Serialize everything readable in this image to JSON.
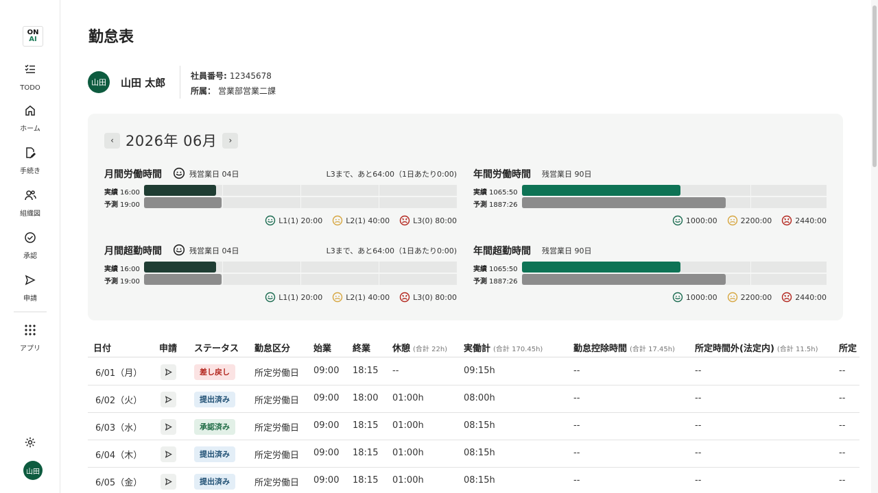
{
  "sidebar": {
    "logo_top": "ON",
    "logo_bottom": "AI",
    "items": [
      {
        "label": "TODO",
        "icon": "todo-list-icon"
      },
      {
        "label": "ホーム",
        "icon": "home-icon"
      },
      {
        "label": "手続き",
        "icon": "document-edit-icon"
      },
      {
        "label": "組織図",
        "icon": "people-icon"
      },
      {
        "label": "承認",
        "icon": "check-circle-icon"
      },
      {
        "label": "申請",
        "icon": "send-icon"
      },
      {
        "label": "アプリ",
        "icon": "grid-icon"
      }
    ],
    "avatar_text": "山田"
  },
  "page": {
    "title": "勤怠表"
  },
  "profile": {
    "avatar_text": "山田",
    "name": "山田 太郎",
    "employee_no_label": "社員番号:",
    "employee_no": "12345678",
    "dept_label": "所属：",
    "dept": "営業部営業二課"
  },
  "summary": {
    "month": "2026年 06月",
    "prev": "‹",
    "next": "›",
    "monthly_work": {
      "title": "月間労働時間",
      "remain": "残営業日 04日",
      "note": "L3まで、あと64:00（1日あたり0:00)",
      "actual_label": "実績",
      "actual_value": "16:00",
      "actual_fraction": 0.23,
      "forecast_label": "予測",
      "forecast_value": "19:00",
      "forecast_fraction": 0.248,
      "thresholds": [
        "L1(1) 20:00",
        "L2(1) 40:00",
        "L3(0) 80:00"
      ]
    },
    "annual_work": {
      "title": "年間労働時間",
      "remain": "残営業日 90日",
      "actual_label": "実績",
      "actual_value": "1065:50",
      "actual_fraction": 0.52,
      "forecast_label": "予測",
      "forecast_value": "1887:26",
      "forecast_fraction": 0.67,
      "thresholds": [
        "1000:00",
        "2200:00",
        "2440:00"
      ]
    },
    "monthly_overtime": {
      "title": "月間超勤時間",
      "remain": "残営業日 04日",
      "note": "L3まで、あと64:00（1日あたり0:00)",
      "actual_label": "実績",
      "actual_value": "16:00",
      "actual_fraction": 0.23,
      "forecast_label": "予測",
      "forecast_value": "19:00",
      "forecast_fraction": 0.248,
      "thresholds": [
        "L1(1) 20:00",
        "L2(1) 40:00",
        "L3(0) 80:00"
      ]
    },
    "annual_overtime": {
      "title": "年間超勤時間",
      "remain": "残営業日 90日",
      "actual_label": "実績",
      "actual_value": "1065:50",
      "actual_fraction": 0.52,
      "forecast_label": "予測",
      "forecast_value": "1887:26",
      "forecast_fraction": 0.67,
      "thresholds": [
        "1000:00",
        "2200:00",
        "2440:00"
      ]
    },
    "colors": {
      "monthly_actual": "#1f3d33",
      "annual_actual": "#0e7355",
      "forecast": "#8c8c8c",
      "good": "#1b6b50",
      "warn": "#d6a640",
      "bad": "#b3261e"
    }
  },
  "table": {
    "headers": {
      "date": "日付",
      "apply": "申請",
      "status": "ステータス",
      "category": "勤怠区分",
      "start": "始業",
      "end": "終業",
      "break": "休憩",
      "break_sub": "(合計 22h)",
      "work": "実働計",
      "work_sub": "(合計 170.45h)",
      "deduct": "勤怠控除時間",
      "deduct_sub": "(合計 17.45h)",
      "outside": "所定時間外(法定内)",
      "outside_sub": "(合計 11.5h)",
      "next": "所定"
    },
    "rows": [
      {
        "date": "6/01（月）",
        "status": "差し戻し",
        "status_type": "return",
        "category": "所定労働日",
        "start": "09:00",
        "end": "18:15",
        "break": "--",
        "work": "09:15h",
        "deduct": "--",
        "outside": "--",
        "next": "--"
      },
      {
        "date": "6/02（火）",
        "status": "提出済み",
        "status_type": "submitted",
        "category": "所定労働日",
        "start": "09:00",
        "end": "18:00",
        "break": "01:00h",
        "work": "08:00h",
        "deduct": "--",
        "outside": "--",
        "next": "--"
      },
      {
        "date": "6/03（水）",
        "status": "承認済み",
        "status_type": "approved",
        "category": "所定労働日",
        "start": "09:00",
        "end": "18:15",
        "break": "01:00h",
        "work": "08:15h",
        "deduct": "--",
        "outside": "--",
        "next": "--"
      },
      {
        "date": "6/04（木）",
        "status": "提出済み",
        "status_type": "submitted",
        "category": "所定労働日",
        "start": "09:00",
        "end": "18:15",
        "break": "01:00h",
        "work": "08:15h",
        "deduct": "--",
        "outside": "--",
        "next": "--"
      },
      {
        "date": "6/05（金）",
        "status": "提出済み",
        "status_type": "submitted",
        "category": "所定労働日",
        "start": "09:00",
        "end": "18:15",
        "break": "01:00h",
        "work": "08:15h",
        "deduct": "--",
        "outside": "--",
        "next": "--"
      }
    ]
  }
}
